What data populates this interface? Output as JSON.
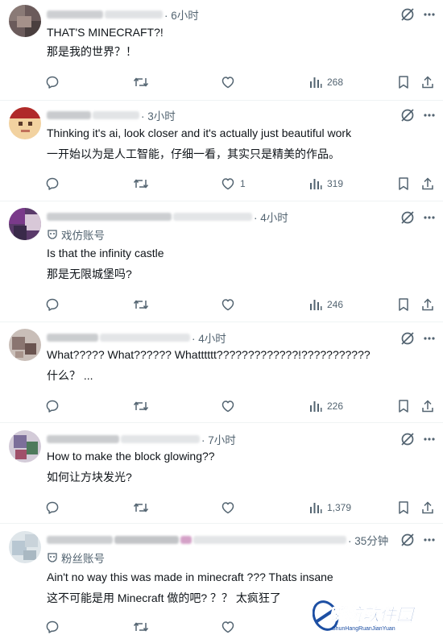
{
  "replies": [
    {
      "time": "· 6小时",
      "badge": "",
      "lines": [
        "THAT'S MINECRAFT?!",
        "那是我的世界？！"
      ],
      "likes": "",
      "views": "268",
      "avatar_color": "#6b5b5b"
    },
    {
      "time": "· 3小时",
      "badge": "",
      "lines": [
        "Thinking it's ai, look closer and it's actually just beautiful work",
        "一开始以为是人工智能，仔细一看，其实只是精美的作品。"
      ],
      "likes": "1",
      "views": "319",
      "avatar_color": "#b02a2a"
    },
    {
      "time": "· 4小时",
      "badge": "戏仿账号",
      "lines": [
        "Is that the infinity castle",
        "那是无限城堡吗?"
      ],
      "likes": "",
      "views": "246",
      "avatar_color": "#7a3a8a"
    },
    {
      "time": "· 4小时",
      "badge": "",
      "lines": [
        "What????? What?????? Whatttttt?????????????!???????????",
        "什么？ ..."
      ],
      "likes": "",
      "views": "226",
      "avatar_color": "#9a8a86"
    },
    {
      "time": "· 7小时",
      "badge": "",
      "lines": [
        "How to make the block glowing??",
        "如何让方块发光?"
      ],
      "likes": "",
      "views": "1,379",
      "avatar_color": "#7c6f9a"
    },
    {
      "time": "· 35分钟",
      "badge": "粉丝账号",
      "lines": [
        "Ain't no way this was made in minecraft ??? Thats insane",
        "这不可能是用 Minecraft 做的吧? ？？ 太疯狂了"
      ],
      "likes": "",
      "views": "",
      "avatar_color": "#b8c7d2"
    }
  ],
  "watermark": {
    "title": "瞬航软件园",
    "subtitle": "ShunHangRuanJianYuan"
  },
  "colors": {
    "text": "#0f1419",
    "secondary": "#536471",
    "divider": "#eff3f4",
    "watermark": "#1d4fa3"
  }
}
